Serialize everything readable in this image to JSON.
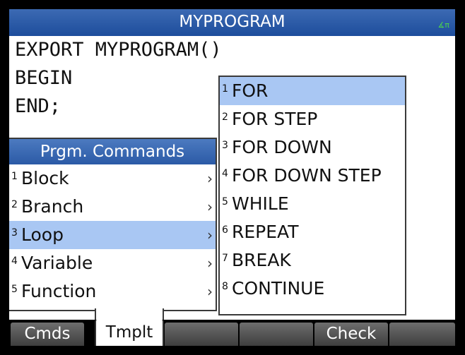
{
  "title": "MYPROGRAM",
  "status_indicator": "∡π",
  "code_lines": [
    "EXPORT MYPROGRAM()",
    "BEGIN",
    "END;"
  ],
  "left_menu": {
    "header": "Prgm. Commands",
    "items": [
      {
        "num": "1",
        "label": "Block"
      },
      {
        "num": "2",
        "label": "Branch"
      },
      {
        "num": "3",
        "label": "Loop"
      },
      {
        "num": "4",
        "label": "Variable"
      },
      {
        "num": "5",
        "label": "Function"
      }
    ],
    "chevron": "›"
  },
  "right_menu": {
    "items": [
      {
        "num": "1",
        "label": "FOR"
      },
      {
        "num": "2",
        "label": "FOR STEP"
      },
      {
        "num": "3",
        "label": "FOR DOWN"
      },
      {
        "num": "4",
        "label": "FOR DOWN STEP"
      },
      {
        "num": "5",
        "label": "WHILE"
      },
      {
        "num": "6",
        "label": "REPEAT"
      },
      {
        "num": "7",
        "label": "BREAK"
      },
      {
        "num": "8",
        "label": "CONTINUE"
      }
    ]
  },
  "softkeys": [
    "Cmds",
    "Tmplt",
    "",
    "",
    "Check",
    ""
  ],
  "colors": {
    "title_bar": "#2a5aa8",
    "selection": "#a9c7f3",
    "indicator": "#4cd24c"
  }
}
